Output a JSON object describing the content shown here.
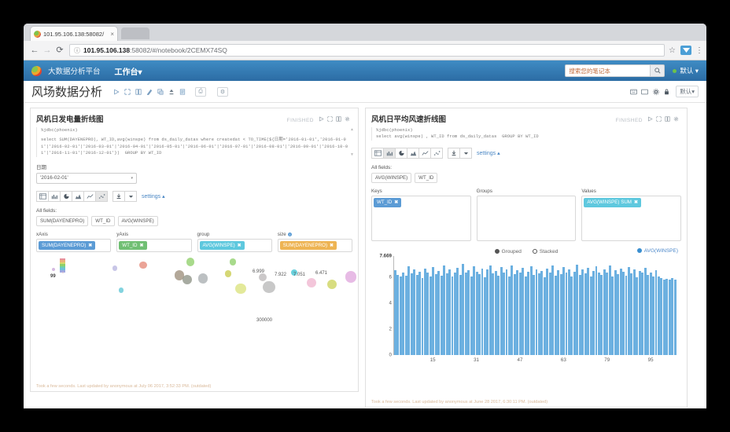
{
  "browser": {
    "tab_title": "101.95.106.138:58082/",
    "tab_close": "×",
    "back": "←",
    "forward": "→",
    "reload": "⟳",
    "security_label": "ⓘ",
    "url_host": "101.95.106.138",
    "url_path": ":58082/#/notebook/2CEMX74SQ",
    "star": "☆",
    "menu": "⋮"
  },
  "appnav": {
    "brand": "大数据分析平台",
    "menu": "工作台▾",
    "search_placeholder": "搜索您的笔记本",
    "search_icon": "⌕",
    "user": "默认 ▾"
  },
  "notebook": {
    "title": "风场数据分析",
    "toolbar_icons": [
      "run-all",
      "collapse-all",
      "show-hide-code",
      "clear-output",
      "clone",
      "export",
      "import"
    ],
    "version_btn": "⎙",
    "settings_btn": "⚙",
    "right_icons": [
      "keyboard",
      "screen",
      "gear",
      "lock"
    ],
    "permissions_label": "默认▾"
  },
  "paragraphs": [
    {
      "title": "风机日发电量折线图",
      "status": "FINISHED",
      "code_line1": "%jdbc(phoenix)",
      "code_line2": "select SUM(DAYENEPRO), WT_ID,avg(winspe) from ds_daily_datas where createdat < TO_TIME(${日期='2016-01-01','2016-01-01'|'2016-02-01'|'2016-03-01'|'2016-04-01'|'2016-05-01'|'2016-06-01'|'2016-07-01'|'2016-08-01'|'2016-09-01'|'2016-10-01'|'2016-11-01'|'2016-12-01'})  GROUP BY WT_ID",
      "form_label": "日期",
      "form_value": "'2016-02-01'",
      "viz_selected": 5,
      "all_fields_label": "All fields:",
      "all_fields": [
        "SUM(DAYENEPRO)",
        "WT_ID",
        "AVG(WINSPE)"
      ],
      "settings_label": "settings ▴",
      "axes": [
        {
          "label": "xAxis",
          "pill": "SUM(DAYENEPRO)",
          "color": "#5b9bd5",
          "info": false
        },
        {
          "label": "yAxis",
          "pill": "WT_ID",
          "color": "#70bf73",
          "info": false
        },
        {
          "label": "group",
          "pill": "AVG(WINSPE)",
          "color": "#5ec8de",
          "info": false
        },
        {
          "label": "size",
          "pill": "SUM(DAYENEPRO)",
          "color": "#eeb453",
          "info": true
        }
      ],
      "footer": "Took a few seconds. Last updated by anonymous at July 06 2017, 3:52:33 PM. (outdated)"
    },
    {
      "title": "风机日平均风速折线图",
      "status": "FINISHED",
      "code_line1": "%jdbc(phoenix)",
      "code_line2": "select avg(winspe) , WT_ID from ds_daily_datas  GROUP BY WT_ID",
      "viz_selected": 1,
      "all_fields_label": "All fields:",
      "all_fields": [
        "AVG(WINSPE)",
        "WT_ID"
      ],
      "settings_label": "settings ▴",
      "zones": [
        {
          "label": "Keys",
          "pill": "WT_ID",
          "color": "#5b9bd5"
        },
        {
          "label": "Groups",
          "pill": null,
          "color": null
        },
        {
          "label": "Values",
          "pill": "AVG(WINSPE) SUM",
          "color": "#5ec8de"
        }
      ],
      "mode_grouped": "Grouped",
      "mode_stacked": "Stacked",
      "mode_selected": "Grouped",
      "footer": "Took a few seconds. Last updated by anonymous at June 28 2017, 6:30:11 PM. (outdated)"
    }
  ],
  "chart_data": [
    {
      "type": "scatter",
      "title": "风机日发电量折线图",
      "xlabel": "SUM(DAYENEPRO)",
      "ylabel": "WT_ID",
      "size_field": "SUM(DAYENEPRO)",
      "group_field": "AVG(WINSPE)",
      "xtick_labels": [
        "300000"
      ],
      "ymin_label": "99",
      "data_labels": [
        "6.999",
        "7.922",
        "7.051",
        "6.471"
      ],
      "points": [
        {
          "x": 2.0,
          "y": 72,
          "r": 2.0,
          "c": "#c9a7d8"
        },
        {
          "x": 5.0,
          "y": 68,
          "r": 1.4,
          "c": "#d8b9c9"
        },
        {
          "x": 21.5,
          "y": 74,
          "r": 3.4,
          "c": "#b9b6e0"
        },
        {
          "x": 23.5,
          "y": 44,
          "r": 3.4,
          "c": "#5fc6d6"
        },
        {
          "x": 30.5,
          "y": 78,
          "r": 4.6,
          "c": "#e58a7a"
        },
        {
          "x": 42.0,
          "y": 64,
          "r": 6.4,
          "c": "#9d8f7c"
        },
        {
          "x": 44.5,
          "y": 58,
          "r": 6.0,
          "c": "#8e9486"
        },
        {
          "x": 45.5,
          "y": 82,
          "r": 5.2,
          "c": "#8fd06a"
        },
        {
          "x": 49.5,
          "y": 60,
          "r": 6.4,
          "c": "#a9aeb1"
        },
        {
          "x": 57.5,
          "y": 66,
          "r": 4.4,
          "c": "#c9cc4e"
        },
        {
          "x": 59.0,
          "y": 82,
          "r": 4.2,
          "c": "#8fd06a"
        },
        {
          "x": 61.5,
          "y": 46,
          "r": 6.6,
          "c": "#dbe37e"
        },
        {
          "x": 68.5,
          "y": 62,
          "r": 5.0,
          "c": "#bdb9ba"
        },
        {
          "x": 70.5,
          "y": 48,
          "r": 7.6,
          "c": "#b9b9b9"
        },
        {
          "x": 78.5,
          "y": 68,
          "r": 4.2,
          "c": "#3fc4d3"
        },
        {
          "x": 84.0,
          "y": 54,
          "r": 6.2,
          "c": "#f0b6cf"
        },
        {
          "x": 90.5,
          "y": 52,
          "r": 6.4,
          "c": "#cdd45c"
        },
        {
          "x": 96.5,
          "y": 62,
          "r": 7.2,
          "c": "#e0a8de"
        }
      ]
    },
    {
      "type": "bar",
      "title": "风机日平均风速折线图",
      "series_name": "AVG(WINSPE)",
      "ylabel": "",
      "xlabel": "",
      "ylim": [
        0,
        7.669
      ],
      "ytick_labels": [
        "7.669",
        "6",
        "4",
        "2",
        "0"
      ],
      "ytick_values": [
        7.669,
        6,
        4,
        2,
        0
      ],
      "xtick_labels": [
        "15",
        "31",
        "47",
        "63",
        "79",
        "95"
      ],
      "xtick_values": [
        15,
        31,
        47,
        63,
        79,
        95
      ],
      "color": "#6cb0e0",
      "legend_position": "top-right",
      "grid": false,
      "values": [
        6.55,
        6.2,
        6.05,
        6.35,
        6.15,
        6.85,
        6.3,
        6.6,
        6.2,
        6.45,
        5.95,
        6.7,
        6.35,
        6.1,
        6.8,
        6.25,
        6.5,
        6.15,
        6.95,
        6.3,
        6.6,
        6.05,
        6.4,
        6.75,
        6.2,
        7.05,
        6.35,
        6.55,
        6.1,
        6.85,
        6.45,
        6.25,
        6.7,
        6.0,
        6.6,
        6.9,
        6.3,
        6.5,
        6.15,
        6.8,
        6.4,
        6.65,
        6.05,
        6.95,
        6.25,
        6.55,
        6.35,
        6.75,
        6.1,
        6.45,
        6.85,
        6.2,
        6.6,
        6.3,
        6.5,
        6.0,
        6.7,
        6.4,
        6.9,
        6.15,
        6.55,
        6.25,
        6.8,
        6.35,
        6.65,
        6.05,
        6.45,
        7.0,
        6.2,
        6.6,
        6.3,
        6.75,
        6.1,
        6.5,
        6.85,
        6.4,
        6.2,
        6.65,
        6.35,
        6.95,
        6.05,
        6.55,
        6.25,
        6.7,
        6.45,
        6.15,
        6.8,
        6.3,
        6.6,
        6.0,
        6.5,
        6.35,
        6.75,
        6.2,
        6.4,
        6.1,
        6.55,
        6.05,
        5.95,
        5.85,
        5.9,
        5.8,
        5.95,
        5.85
      ]
    }
  ]
}
